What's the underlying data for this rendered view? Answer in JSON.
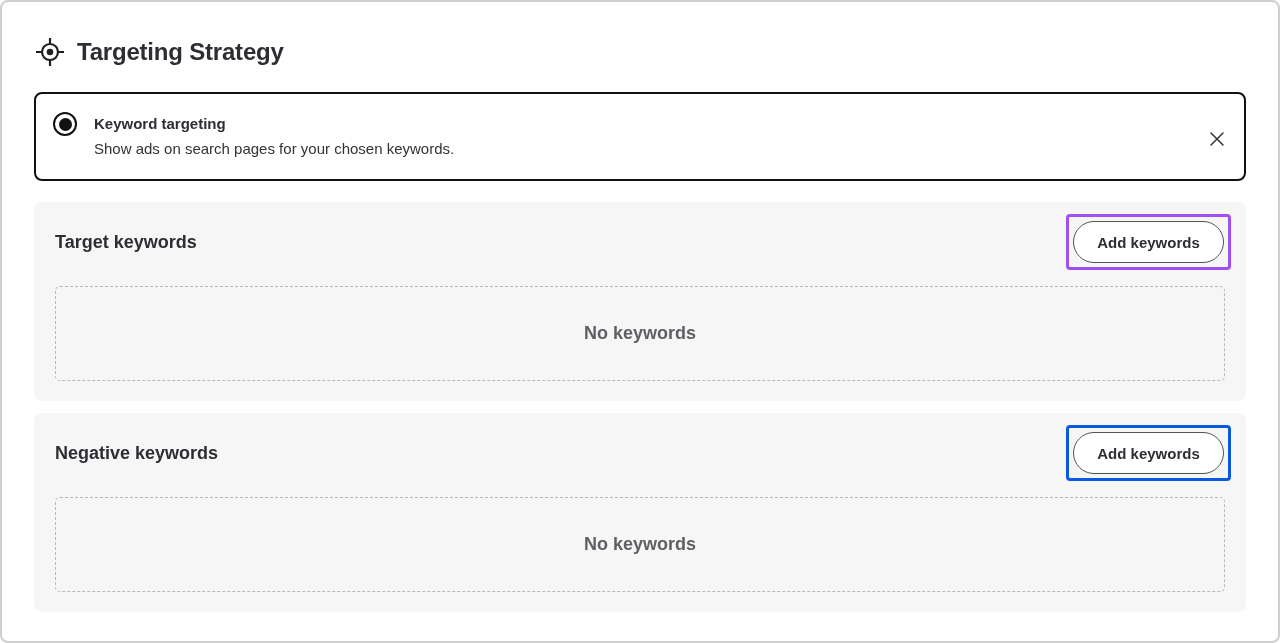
{
  "header": {
    "title": "Targeting Strategy"
  },
  "option": {
    "title": "Keyword targeting",
    "description": "Show ads on search pages for your chosen keywords.",
    "selected": true
  },
  "sections": [
    {
      "title": "Target keywords",
      "button": {
        "label": "Add keywords"
      },
      "highlight": {
        "color": "#a24ff2"
      },
      "empty_state": "No keywords"
    },
    {
      "title": "Negative keywords",
      "button": {
        "label": "Add keywords"
      },
      "highlight": {
        "color": "#0a5adf"
      },
      "empty_state": "No keywords"
    }
  ]
}
